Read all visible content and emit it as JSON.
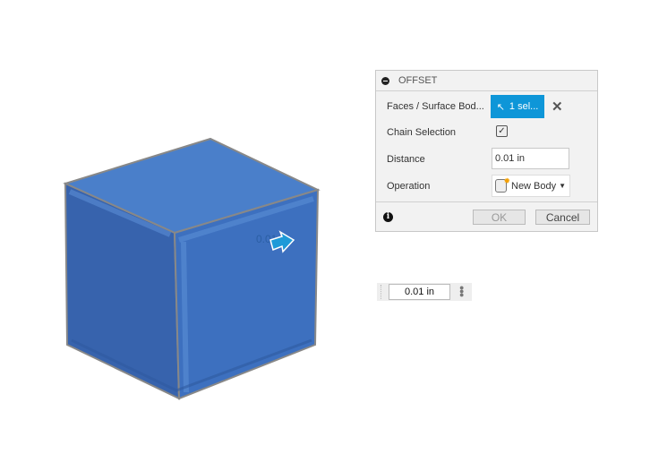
{
  "viewport": {
    "manipulator_label": "0.01",
    "colors": {
      "body_top": "#4a7fca",
      "body_left": "#3763ad",
      "body_right": "#3d70bf",
      "arrow": "#1e9ad8"
    }
  },
  "offset_panel": {
    "title": "OFFSET",
    "rows": {
      "faces_label": "Faces / Surface Bod...",
      "faces_value": "1 sel...",
      "chain_label": "Chain Selection",
      "chain_checked": true,
      "distance_label": "Distance",
      "distance_value": "0.01 in",
      "operation_label": "Operation",
      "operation_value": "New Body"
    },
    "ok_label": "OK",
    "cancel_label": "Cancel",
    "accent": "#0e96d8"
  },
  "mini_toolbar": {
    "value": "0.01 in"
  }
}
